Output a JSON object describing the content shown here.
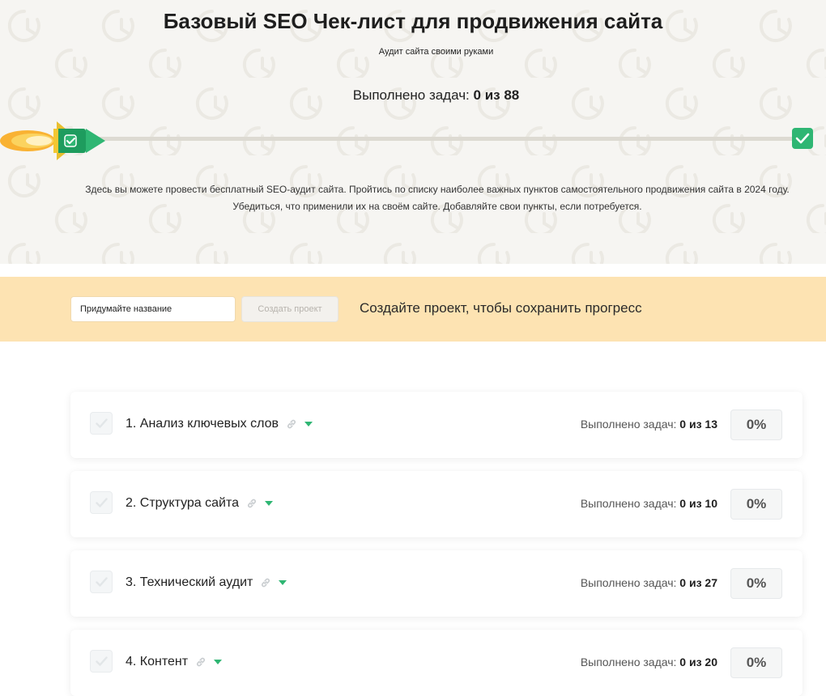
{
  "header": {
    "title": "Базовый SEO Чек-лист для продвижения сайта",
    "subtitle": "Аудит сайта своими руками",
    "counter_label": "Выполнено задач:",
    "counter_value": "0 из 88",
    "progress_fraction": 0,
    "description_line1": "Здесь вы можете провести бесплатный SEO-аудит сайта. Пройтись по списку наиболее важных пунктов самостоятельного продвижения сайта в 2024 году.",
    "description_line2": "Убедиться, что применили их на своём сайте. Добавляйте свои пункты, если потребуется."
  },
  "project": {
    "input_placeholder": "Придумайте название",
    "input_value": "",
    "button_label": "Создать проект",
    "hint": "Создайте проект, чтобы сохранить прогресс"
  },
  "sections": [
    {
      "title": "1. Анализ ключевых слов",
      "stats_label": "Выполнено задач:",
      "stats_value": "0 из 13",
      "percent": "0%"
    },
    {
      "title": "2. Структура сайта",
      "stats_label": "Выполнено задач:",
      "stats_value": "0 из 10",
      "percent": "0%"
    },
    {
      "title": "3. Технический аудит",
      "stats_label": "Выполнено задач:",
      "stats_value": "0 из 27",
      "percent": "0%"
    },
    {
      "title": "4. Контент",
      "stats_label": "Выполнено задач:",
      "stats_value": "0 из 20",
      "percent": "0%"
    }
  ],
  "colors": {
    "accent": "#2fb673",
    "hero_background": "#f6f5f2",
    "project_bar": "#fde3b2",
    "rocket_body": "#1e9c5e",
    "flame": "#f6c13a"
  },
  "icons": {
    "rocket": "rocket-icon",
    "finish": "check-icon",
    "section_checkbox": "check-icon",
    "section_link": "link-icon",
    "section_toggle": "chevron-down-icon"
  }
}
